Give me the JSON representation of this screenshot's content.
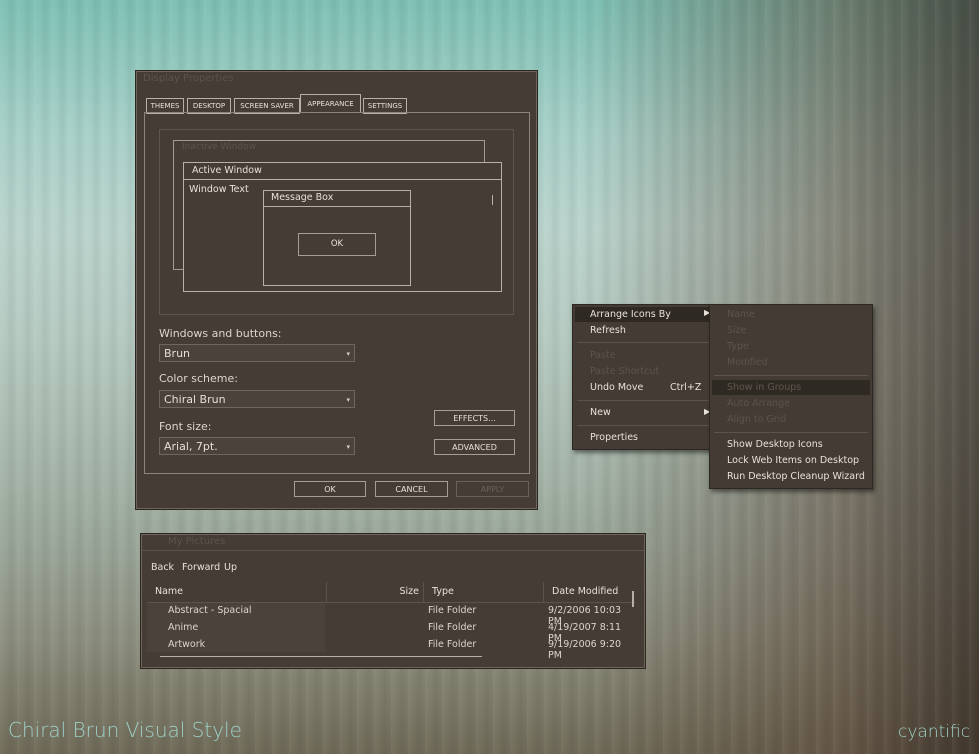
{
  "display_props": {
    "title": "Display Properties",
    "tabs": [
      "THEMES",
      "DESKTOP",
      "SCREEN SAVER",
      "APPEARANCE",
      "SETTINGS"
    ],
    "preview": {
      "inactive_window": "Inactive Window",
      "active_window": "Active Window",
      "window_text": "Window Text",
      "message_box": "Message Box",
      "ok": "OK"
    },
    "windows_buttons_label": "Windows and buttons:",
    "windows_buttons_value": "Brun",
    "color_scheme_label": "Color scheme:",
    "color_scheme_value": "Chiral Brun",
    "font_size_label": "Font size:",
    "font_size_value": "Arial, 7pt.",
    "effects": "EFFECTS...",
    "advanced": "ADVANCED",
    "ok": "OK",
    "cancel": "CANCEL",
    "apply": "APPLY"
  },
  "context_menu": {
    "items": [
      "Arrange Icons By",
      "Refresh",
      "Paste",
      "Paste Shortcut",
      "Undo Move",
      "New",
      "Properties"
    ],
    "undo_shortcut": "Ctrl+Z",
    "submenu": [
      "Name",
      "Size",
      "Type",
      "Modified",
      "Show in Groups",
      "Auto Arrange",
      "Align to Grid",
      "Show Desktop Icons",
      "Lock Web Items on Desktop",
      "Run Desktop Cleanup Wizard"
    ]
  },
  "explorer": {
    "title": "My Pictures",
    "nav": [
      "Back",
      "Forward",
      "Up"
    ],
    "columns": [
      "Name",
      "Size",
      "Type",
      "Date Modified"
    ],
    "rows": [
      {
        "name": "Abstract - Spacial",
        "type": "File Folder",
        "date": "9/2/2006 10:03 PM"
      },
      {
        "name": "Anime",
        "type": "File Folder",
        "date": "4/19/2007 8:11 PM"
      },
      {
        "name": "Artwork",
        "type": "File Folder",
        "date": "9/19/2006 9:20 PM"
      }
    ]
  },
  "branding": {
    "left": "Chiral Brun Visual Style",
    "right": "cyantific"
  }
}
